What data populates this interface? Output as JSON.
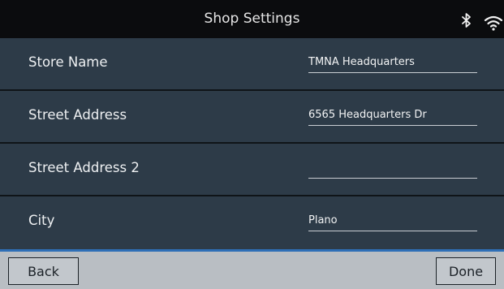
{
  "header": {
    "title": "Shop Settings",
    "icons": [
      "bluetooth-icon",
      "wifi-icon"
    ]
  },
  "fields": [
    {
      "label": "Store Name",
      "value": "TMNA Headquarters"
    },
    {
      "label": "Street Address",
      "value": "6565 Headquarters Dr"
    },
    {
      "label": "Street Address 2",
      "value": ""
    },
    {
      "label": "City",
      "value": "Plano"
    }
  ],
  "footer": {
    "back_label": "Back",
    "done_label": "Done"
  },
  "colors": {
    "header_bg": "#0b0c0e",
    "content_bg": "#2d3b48",
    "footer_bg": "#b9bec3",
    "accent_line": "#2e6fb7"
  }
}
